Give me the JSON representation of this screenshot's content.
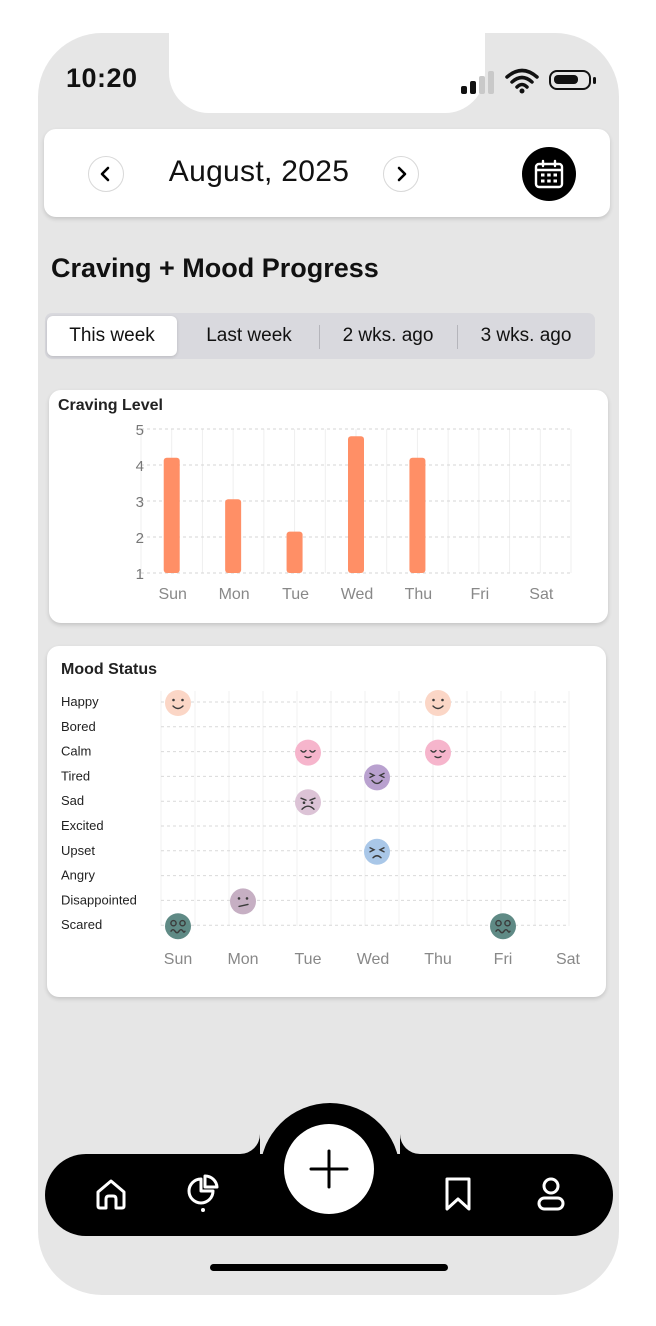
{
  "status_bar": {
    "time": "10:20"
  },
  "header": {
    "month_label": "August, 2025"
  },
  "page": {
    "title": "Craving + Mood Progress"
  },
  "tabs": [
    {
      "label": "This week",
      "active": true
    },
    {
      "label": "Last week",
      "active": false
    },
    {
      "label": "2 wks. ago",
      "active": false
    },
    {
      "label": "3 wks. ago",
      "active": false
    }
  ],
  "craving": {
    "title": "Craving Level"
  },
  "mood": {
    "title": "Mood Status"
  },
  "colors": {
    "bar": "#ff8f66",
    "accent": "#000000",
    "background": "#e6e6e6"
  },
  "chart_data": [
    {
      "type": "bar",
      "title": "Craving Level",
      "categories": [
        "Sun",
        "Mon",
        "Tue",
        "Wed",
        "Thu",
        "Fri",
        "Sat"
      ],
      "values": [
        4.2,
        3.05,
        2.15,
        4.8,
        4.2,
        null,
        null
      ],
      "ylim": [
        1,
        5
      ],
      "yticks": [
        "1",
        "2",
        "3",
        "4",
        "5"
      ],
      "grid": true
    },
    {
      "type": "scatter",
      "title": "Mood Status",
      "categories": [
        "Sun",
        "Mon",
        "Tue",
        "Wed",
        "Thu",
        "Fri",
        "Sat"
      ],
      "moods": [
        "Happy",
        "Bored",
        "Calm",
        "Tired",
        "Sad",
        "Excited",
        "Upset",
        "Angry",
        "Disappointed",
        "Scared"
      ],
      "points": [
        {
          "day": "Sun",
          "mood": "Happy",
          "color": "#fbd6c6",
          "face": "happy"
        },
        {
          "day": "Sun",
          "mood": "Scared",
          "color": "#5f8a85",
          "face": "scared"
        },
        {
          "day": "Mon",
          "mood": "Disappointed",
          "color": "#c6afc3",
          "face": "disappointed"
        },
        {
          "day": "Tue",
          "mood": "Calm",
          "color": "#f6b5cc",
          "face": "calm"
        },
        {
          "day": "Tue",
          "mood": "Sad",
          "color": "#dcc3d6",
          "face": "sad"
        },
        {
          "day": "Wed",
          "mood": "Tired",
          "color": "#b9a1cf",
          "face": "tired"
        },
        {
          "day": "Wed",
          "mood": "Upset",
          "color": "#a9c7e8",
          "face": "upset"
        },
        {
          "day": "Thu",
          "mood": "Happy",
          "color": "#fbd6c6",
          "face": "happy"
        },
        {
          "day": "Thu",
          "mood": "Calm",
          "color": "#f6b5cc",
          "face": "calm"
        },
        {
          "day": "Fri",
          "mood": "Scared",
          "color": "#5f8a85",
          "face": "scared"
        }
      ],
      "grid": true
    }
  ],
  "nav": {
    "items": [
      {
        "icon": "home-icon"
      },
      {
        "icon": "pie-chart-icon"
      },
      {
        "icon": "plus-icon"
      },
      {
        "icon": "bookmark-icon"
      },
      {
        "icon": "profile-icon"
      }
    ]
  }
}
